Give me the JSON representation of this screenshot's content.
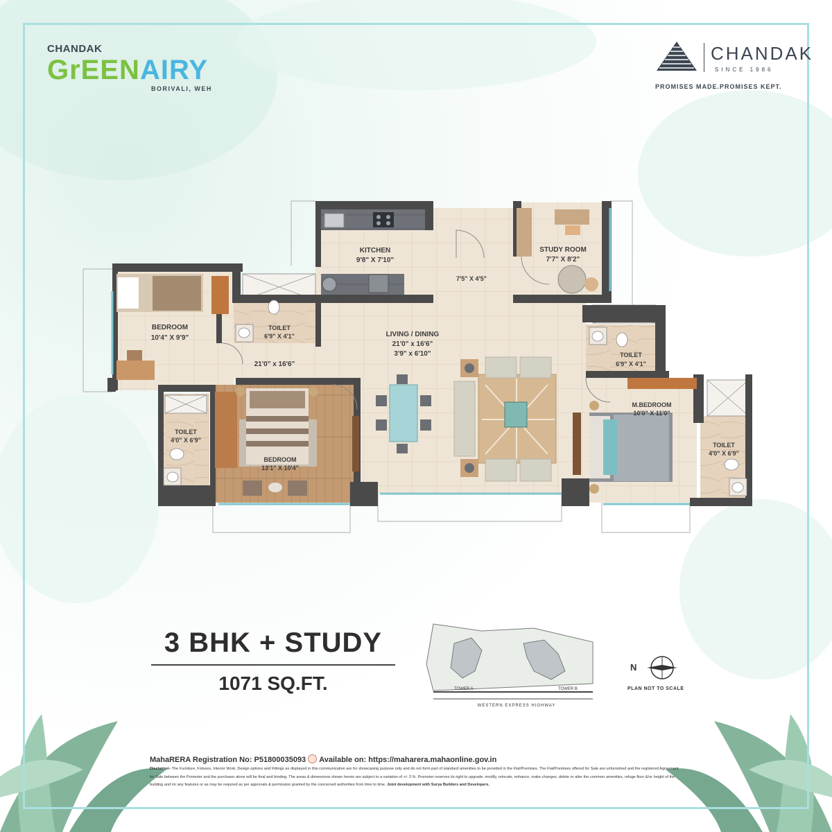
{
  "logo": {
    "company_small": "CHANDAK",
    "project_part1": "GrEEN",
    "project_part2": "AIRY",
    "location": "BORIVALI, WEH"
  },
  "brand": {
    "name": "CHANDAK",
    "since": "SINCE 1986",
    "tagline": "PROMISES MADE.PROMISES KEPT."
  },
  "rooms": {
    "kitchen": {
      "name": "KITCHEN",
      "size": "9'8\" X 7'10\""
    },
    "study": {
      "name": "STUDY ROOM",
      "size": "7'7\" X 8'2\""
    },
    "passage": {
      "size": "7'5\" X 4'5\""
    },
    "bedroom1": {
      "name": "BEDROOM",
      "size": "10'4\" X 9'9\""
    },
    "toilet1": {
      "name": "TOILET",
      "size": "6'9\" X 4'1\""
    },
    "living": {
      "name": "LIVING / DINING",
      "size1": "21'0\" x 16'6\"",
      "size2": "3'9\" x 6'10\""
    },
    "lobby": {
      "size": "21'0\" x 16'6\""
    },
    "toilet2": {
      "name": "TOILET",
      "size": "6'9\" X 4'1\""
    },
    "toilet3": {
      "name": "TOILET",
      "size": "4'0\" X 6'9\""
    },
    "bedroom2": {
      "name": "BEDROOM",
      "size": "13'1\" X 10'4\""
    },
    "mbedroom": {
      "name": "M.BEDROOM",
      "size": "10'0\" X 11'0\""
    },
    "toilet4": {
      "name": "TOILET",
      "size": "4'0\" X 6'9\""
    }
  },
  "unit": {
    "type": "3 BHK + STUDY",
    "area": "1071 SQ.FT."
  },
  "keyplan": {
    "tower_a": "TOWER A",
    "tower_b": "TOWER B",
    "road": "WESTERN EXPRESS HIGHWAY"
  },
  "compass": {
    "north": "N",
    "note": "PLAN NOT TO SCALE"
  },
  "footer": {
    "rera": "MahaRERA Registration No: P51800035093",
    "available": "Available on: https://maharera.mahaonline.gov.in",
    "disclaimer_label": "Disclaimer-",
    "disclaimer": " The Furniture, Fixtures, Interior Work, Design options and Fittings as displayed in this communication are for showcasing purpose only and do not form part of standard amenities to be provided in the Flat/Premises. The Flat/Premises offered for Sale are unfurnished and the registered Agreement for Sale between the Promoter and the purchaser alone will be final and binding. The areas & dimensions shown herein are subject to a variation of +/- 3 %. Promoter reserves its right to upgrade, modify, relocate, enhance, make changes, delete or alter the common amenities, refuge floor &/or height of the building and /or any features or as may be required as per approvals & permission granted by the concerned authorities from time to time.",
    "joint": "Joint development with Surya Builders and Developers."
  }
}
